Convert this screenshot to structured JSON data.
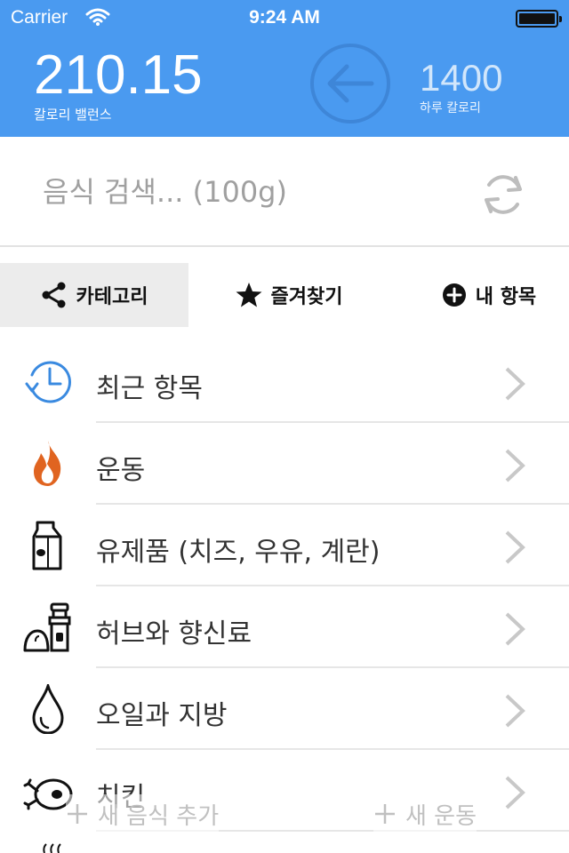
{
  "status": {
    "carrier": "Carrier",
    "time": "9:24 AM"
  },
  "header": {
    "balance_value": "210.15",
    "balance_label": "칼로리 밸런스",
    "daily_value": "1400",
    "daily_label": "하루 칼로리",
    "colors": {
      "background": "#4a9af0",
      "back_circle": "#3e86d8"
    }
  },
  "search": {
    "placeholder": "음식 검색... (100g)"
  },
  "tabs": [
    {
      "label": "카테고리",
      "icon": "share-icon",
      "active": true
    },
    {
      "label": "즐겨찾기",
      "icon": "star-icon",
      "active": false
    },
    {
      "label": "내 항목",
      "icon": "plus-circle-icon",
      "active": false
    }
  ],
  "list": [
    {
      "label": "최근 항목",
      "icon": "clock-history-icon"
    },
    {
      "label": "운동",
      "icon": "flame-icon"
    },
    {
      "label": "유제품 (치즈, 우유, 계란)",
      "icon": "milk-carton-icon"
    },
    {
      "label": "허브와 향신료",
      "icon": "spice-grinder-icon"
    },
    {
      "label": "오일과 지방",
      "icon": "oil-drop-icon"
    },
    {
      "label": "치킨",
      "icon": "roast-chicken-icon"
    }
  ],
  "bottom": {
    "add_food": "새 음식 추가",
    "add_exercise": "새 운동"
  }
}
